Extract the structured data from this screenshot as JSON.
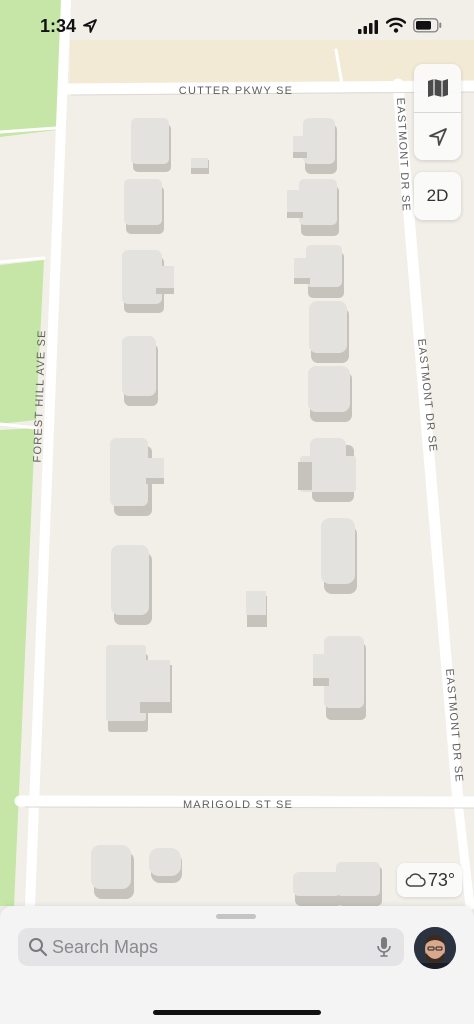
{
  "status_bar": {
    "time": "1:34",
    "icons": [
      "location-arrow-icon",
      "cellular-signal-icon",
      "wifi-icon",
      "battery-icon"
    ]
  },
  "map": {
    "streets": [
      {
        "name": "CUTTER PKWY SE"
      },
      {
        "name": "EASTMONT DR SE"
      },
      {
        "name": "FOREST HILL AVE SE"
      },
      {
        "name": "MARIGOLD ST SE"
      }
    ],
    "colors": {
      "land": "#f2efe9",
      "park": "#c5e6a6",
      "road": "#ffffff",
      "building": "#e4e2de",
      "building_shadow": "#c6c3bd"
    }
  },
  "controls": {
    "map_mode_icon": "map-icon",
    "location_icon": "location-arrow-icon",
    "view_toggle_label": "2D"
  },
  "weather": {
    "icon": "cloud-icon",
    "temperature": "73°"
  },
  "search": {
    "placeholder": "Search Maps",
    "icons": [
      "search-icon",
      "microphone-icon",
      "profile-avatar"
    ]
  }
}
